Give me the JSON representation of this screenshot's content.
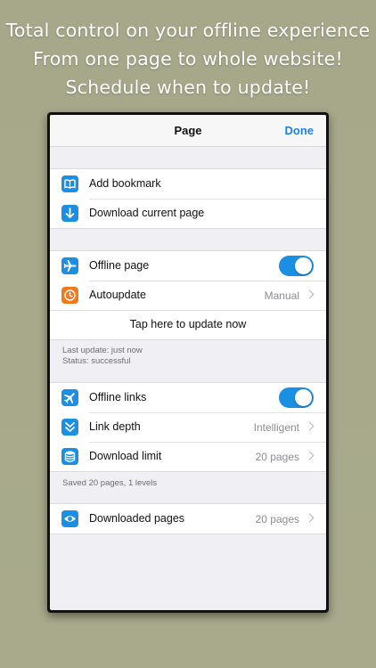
{
  "headline": {
    "line1": "Total control on your offline experience",
    "line2": "From one page to whole website!",
    "line3": "Schedule when to update!"
  },
  "navbar": {
    "title": "Page",
    "done_label": "Done"
  },
  "group1": {
    "add_bookmark": {
      "label": "Add bookmark",
      "icon": "book-icon"
    },
    "download_current": {
      "label": "Download current page",
      "icon": "download-arrow-icon"
    }
  },
  "group2": {
    "offline_page": {
      "label": "Offline page",
      "icon": "airplane-icon",
      "toggle_on": true
    },
    "autoupdate": {
      "label": "Autoupdate",
      "value": "Manual",
      "icon": "clock-icon"
    },
    "update_now": {
      "label": "Tap here to update now"
    }
  },
  "footnote1": {
    "line1": "Last update: just now",
    "line2": "Status: successful"
  },
  "group3": {
    "offline_links": {
      "label": "Offline links",
      "icon": "airplane-links-icon",
      "toggle_on": true
    },
    "link_depth": {
      "label": "Link depth",
      "value": "Intelligent",
      "icon": "chevrons-down-icon"
    },
    "download_limit": {
      "label": "Download limit",
      "value": "20 pages",
      "icon": "database-icon"
    }
  },
  "footnote2": {
    "line1": "Saved 20 pages, 1 levels"
  },
  "group4": {
    "downloaded_pages": {
      "label": "Downloaded pages",
      "value": "20 pages",
      "icon": "eye-icon"
    }
  },
  "colors": {
    "accent": "#1a8fe3",
    "orange_icon": "#f07a1c",
    "background": "#a8a98a"
  }
}
